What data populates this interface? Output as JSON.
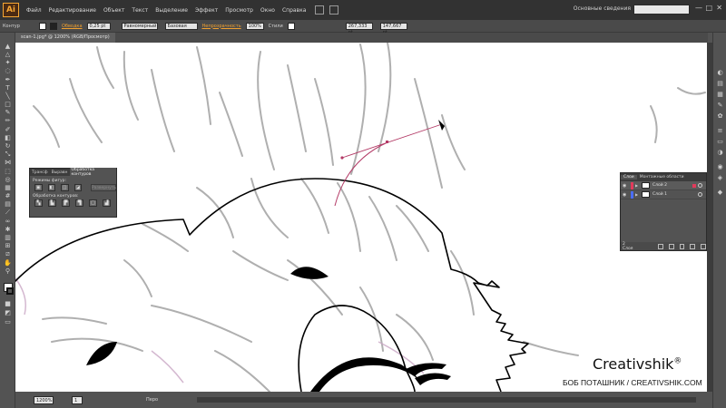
{
  "app": {
    "logo": "Ai"
  },
  "menu": {
    "items": [
      "Файл",
      "Редактирование",
      "Объект",
      "Текст",
      "Выделение",
      "Эффект",
      "Просмотр",
      "Окно",
      "Справка"
    ],
    "workspace": "Основные сведения",
    "win_controls": [
      "—",
      "□",
      "✕"
    ]
  },
  "control_bar": {
    "object_label": "Контур",
    "stroke_label": "Обводка",
    "stroke_value": "0,25 pt",
    "profile": "Равномерный",
    "brush": "Базовая",
    "opacity_label": "Непрозрачность",
    "opacity_value": "100%",
    "style_label": "Стили",
    "x_value": "267,333 pt",
    "y_value": "147,667 pt"
  },
  "document": {
    "tab": "scan-1.jpg* @ 1200% (RGB/Просмотр)"
  },
  "status_bar": {
    "zoom": "1200%",
    "page": "1",
    "status": "Перо"
  },
  "pathfinder": {
    "tabs": [
      "Трансф",
      "Выравн",
      "Обработка контуров"
    ],
    "shape_modes_label": "Режимы фигур:",
    "expand_label": "Развернуть",
    "pathfinders_label": "Обработка контуров:"
  },
  "layers": {
    "tabs": [
      "Слои",
      "Монтажные области"
    ],
    "rows": [
      {
        "name": "Слой 2",
        "color": "#e23a5b",
        "selected": true
      },
      {
        "name": "Слой 1",
        "color": "#4a6cf5",
        "selected": false
      }
    ],
    "count": "2 Слоя"
  },
  "watermark": {
    "brand": "Creativshik",
    "symbol": "®",
    "subtitle": "БОБ ПОТАШНИК / CREATIVSHIK.COM"
  },
  "colors": {
    "accent": "#f7a733",
    "pen_path": "#b33a66",
    "sketch": "#9a9a9a"
  }
}
